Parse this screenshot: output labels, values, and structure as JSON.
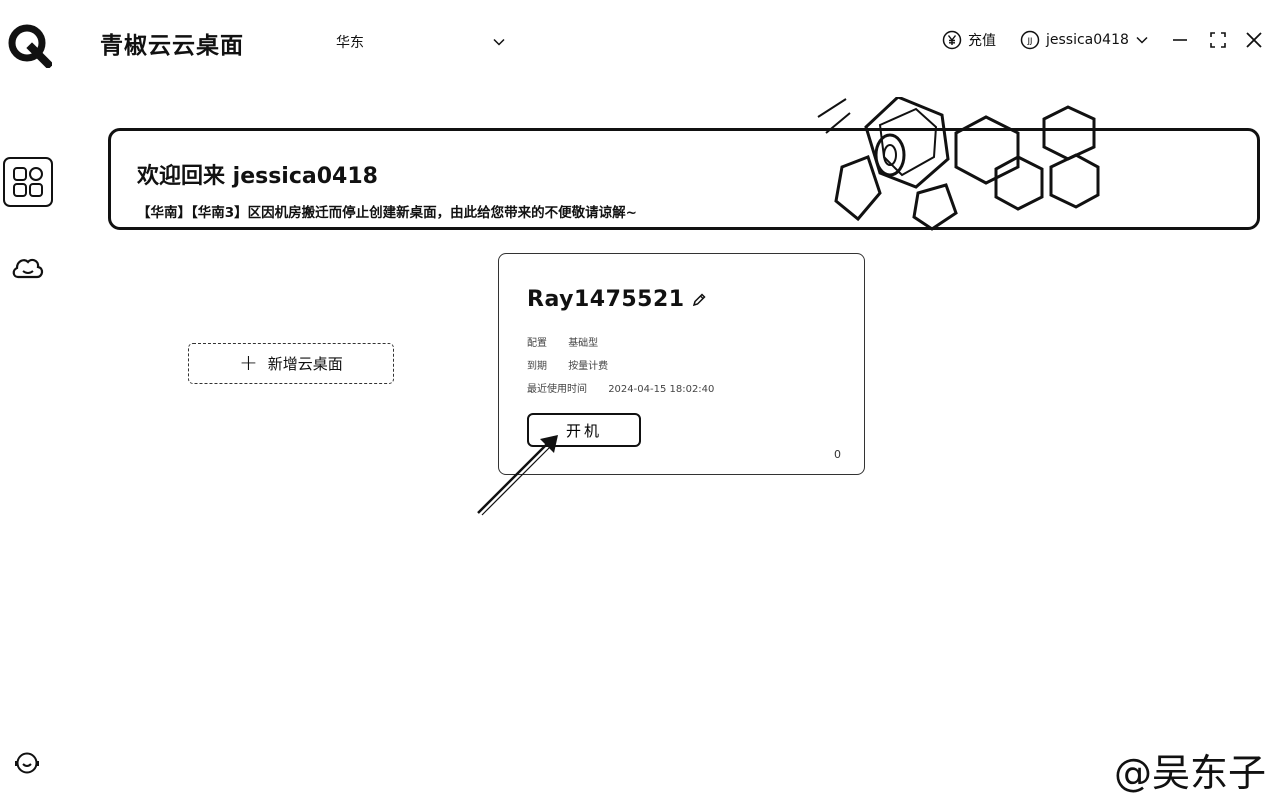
{
  "app": {
    "title": "青椒云云桌面"
  },
  "header": {
    "region": "华东",
    "recharge_label": "充值",
    "username": "jessica0418",
    "user_avatar_text": "JJ"
  },
  "banner": {
    "title": "欢迎回来 jessica0418",
    "notice": "【华南】【华南3】区因机房搬迁而停止创建新桌面，由此给您带来的不便敬请谅解~"
  },
  "add_desktop": {
    "label": "新增云桌面"
  },
  "desktop_card": {
    "name": "Ray1475521",
    "info": [
      {
        "label": "配置",
        "value": "基础型"
      },
      {
        "label": "到期",
        "value": "按量计费"
      },
      {
        "label": "最近使用时间",
        "value": "2024-04-15 18:02:40"
      }
    ],
    "power_button": "开机",
    "status": "0"
  },
  "watermark": "@吴东子",
  "colors": {
    "ink": "#111111",
    "background": "#ffffff"
  }
}
